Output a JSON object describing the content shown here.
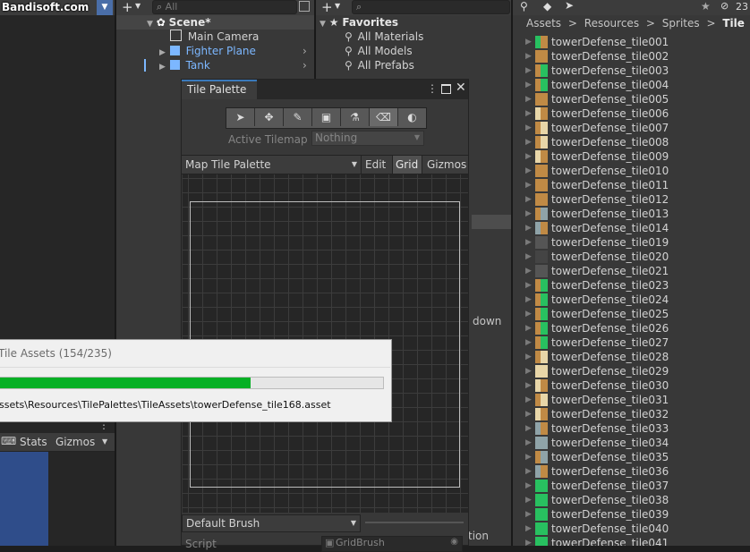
{
  "watermark": "Bandisoft.com",
  "hierarchy": {
    "search_placeholder": "All",
    "scene_name": "Scene*",
    "items": [
      {
        "label": "Main Camera",
        "color": "#d2d2d2"
      },
      {
        "label": "Fighter Plane",
        "color": "#7cb7ff"
      },
      {
        "label": "Tank",
        "color": "#7cb7ff"
      }
    ]
  },
  "favorites": {
    "title": "Favorites",
    "items": [
      "All Materials",
      "All Models",
      "All Prefabs"
    ]
  },
  "project": {
    "breadcrumb": [
      "Assets",
      "Resources",
      "Sprites",
      "Tile"
    ],
    "breadcrumb_sep": ">",
    "counter": "23",
    "items": [
      {
        "name": "towerDefense_tile001",
        "thumb": "#c08a45",
        "accent": "#28c060"
      },
      {
        "name": "towerDefense_tile002",
        "thumb": "#c08a45",
        "accent": ""
      },
      {
        "name": "towerDefense_tile003",
        "thumb": "#28c060",
        "accent": "#c08a45"
      },
      {
        "name": "towerDefense_tile004",
        "thumb": "#28c060",
        "accent": "#c08a45"
      },
      {
        "name": "towerDefense_tile005",
        "thumb": "#c08a45",
        "accent": ""
      },
      {
        "name": "towerDefense_tile006",
        "thumb": "#c08a45",
        "accent": "#e8d6a8"
      },
      {
        "name": "towerDefense_tile007",
        "thumb": "#e8d6a8",
        "accent": "#c08a45"
      },
      {
        "name": "towerDefense_tile008",
        "thumb": "#e8d6a8",
        "accent": "#c08a45"
      },
      {
        "name": "towerDefense_tile009",
        "thumb": "#c08a45",
        "accent": "#e8d6a8"
      },
      {
        "name": "towerDefense_tile010",
        "thumb": "#c08a45",
        "accent": ""
      },
      {
        "name": "towerDefense_tile011",
        "thumb": "#c08a45",
        "accent": ""
      },
      {
        "name": "towerDefense_tile012",
        "thumb": "#c08a45",
        "accent": ""
      },
      {
        "name": "towerDefense_tile013",
        "thumb": "#8fa3a8",
        "accent": "#c08a45"
      },
      {
        "name": "towerDefense_tile014",
        "thumb": "#c08a45",
        "accent": "#8fa3a8"
      },
      {
        "name": "towerDefense_tile019",
        "thumb": "#555555",
        "accent": ""
      },
      {
        "name": "towerDefense_tile020",
        "thumb": "#444444",
        "accent": ""
      },
      {
        "name": "towerDefense_tile021",
        "thumb": "#555555",
        "accent": ""
      },
      {
        "name": "towerDefense_tile023",
        "thumb": "#28c060",
        "accent": "#c08a45"
      },
      {
        "name": "towerDefense_tile024",
        "thumb": "#28c060",
        "accent": "#c08a45"
      },
      {
        "name": "towerDefense_tile025",
        "thumb": "#28c060",
        "accent": "#c08a45"
      },
      {
        "name": "towerDefense_tile026",
        "thumb": "#28c060",
        "accent": "#c08a45"
      },
      {
        "name": "towerDefense_tile027",
        "thumb": "#28c060",
        "accent": "#c08a45"
      },
      {
        "name": "towerDefense_tile028",
        "thumb": "#e8d6a8",
        "accent": "#c08a45"
      },
      {
        "name": "towerDefense_tile029",
        "thumb": "#e8d6a8",
        "accent": ""
      },
      {
        "name": "towerDefense_tile030",
        "thumb": "#c08a45",
        "accent": "#e8d6a8"
      },
      {
        "name": "towerDefense_tile031",
        "thumb": "#e8d6a8",
        "accent": "#c08a45"
      },
      {
        "name": "towerDefense_tile032",
        "thumb": "#c08a45",
        "accent": "#e8d6a8"
      },
      {
        "name": "towerDefense_tile033",
        "thumb": "#c08a45",
        "accent": "#8fa3a8"
      },
      {
        "name": "towerDefense_tile034",
        "thumb": "#8fa3a8",
        "accent": ""
      },
      {
        "name": "towerDefense_tile035",
        "thumb": "#8fa3a8",
        "accent": "#c08a45"
      },
      {
        "name": "towerDefense_tile036",
        "thumb": "#c08a45",
        "accent": "#8fa3a8"
      },
      {
        "name": "towerDefense_tile037",
        "thumb": "#28c060",
        "accent": ""
      },
      {
        "name": "towerDefense_tile038",
        "thumb": "#28c060",
        "accent": ""
      },
      {
        "name": "towerDefense_tile039",
        "thumb": "#28c060",
        "accent": ""
      },
      {
        "name": "towerDefense_tile040",
        "thumb": "#28c060",
        "accent": ""
      },
      {
        "name": "towerDefense_tile041",
        "thumb": "#28c060",
        "accent": ""
      }
    ]
  },
  "tile_palette": {
    "tab_title": "Tile Palette",
    "active_tilemap_label": "Active Tilemap",
    "active_tilemap_value": "Nothing",
    "palette_dropdown": "Map Tile Palette",
    "edit_label": "Edit",
    "grid_label": "Grid",
    "gizmos_label": "Gizmos",
    "brush_dropdown": "Default Brush",
    "script_label": "Script",
    "script_value": "GridBrush",
    "tools": [
      "select-tool",
      "move-tool",
      "paint-brush-tool",
      "box-fill-tool",
      "eyedropper-tool",
      "eraser-tool",
      "fill-tool"
    ],
    "active_tool_index": 5
  },
  "progress_dialog": {
    "title": "Tile Assets (154/235)",
    "progress_fraction": 0.6553,
    "path": "ssets\\Resources\\TilePalettes\\TileAssets\\towerDefense_tile168.asset",
    "bar_color": "#06b025"
  },
  "scene_view": {
    "stats_label": "Stats",
    "gizmos_label": "Gizmos"
  },
  "background_text": {
    "down_label": "down",
    "tion_label": "tion"
  }
}
